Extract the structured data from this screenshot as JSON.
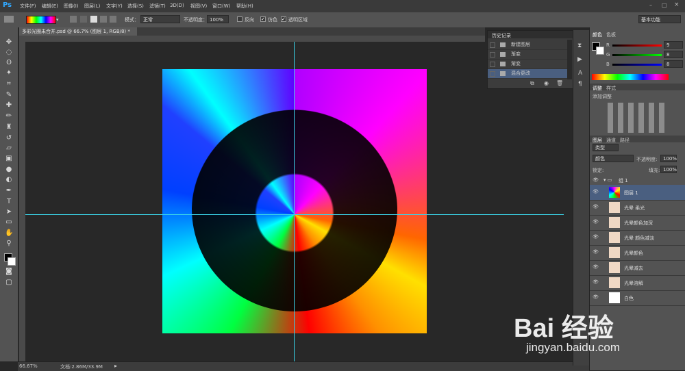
{
  "app": {
    "logo": "Ps"
  },
  "menu": [
    "文件(F)",
    "编辑(E)",
    "图像(I)",
    "图层(L)",
    "文字(Y)",
    "选择(S)",
    "滤镜(T)",
    "3D(D)",
    "视图(V)",
    "窗口(W)",
    "帮助(H)"
  ],
  "options": {
    "mode_label": "模式：",
    "mode_value": "正常",
    "opacity_label": "不透明度：",
    "opacity_value": "100%",
    "reverse_label": "反向",
    "dither_label": "仿色",
    "transparency_label": "透明区域",
    "workspace": "基本功能"
  },
  "document": {
    "tab_title": "多彩光圈未合并.psd @ 66.7% (图层 1, RGB/8) *",
    "zoom": "66.67%",
    "doc_info": "文档:2.86M/33.9M"
  },
  "history": {
    "title": "历史记录",
    "items": [
      "新建图层",
      "渐变",
      "渐变",
      "混合更改"
    ]
  },
  "color_panel": {
    "tab_color": "颜色",
    "tab_swatches": "色板",
    "r_label": "R",
    "g_label": "G",
    "b_label": "B",
    "r": "9",
    "g": "8",
    "b": "8"
  },
  "adjustments": {
    "tab_adjust": "调整",
    "tab_styles": "样式",
    "add_label": "添加调整"
  },
  "layers_panel": {
    "tab_layers": "图层",
    "tab_channels": "通道",
    "tab_paths": "路径",
    "filter_kind": "类型",
    "blend_mode": "颜色",
    "opacity_label": "不透明度:",
    "opacity_value": "100%",
    "lock_label": "锁定:",
    "fill_label": "填充:",
    "fill_value": "100%",
    "group_name": "组 1",
    "layers": [
      "图层 1",
      "光晕 柔光",
      "光晕颜色加深",
      "光晕 颜色减淡",
      "光晕颜色",
      "光晕减去",
      "光晕溶解",
      "白色"
    ]
  },
  "watermark": {
    "brand": "Bai 经验",
    "url": "jingyan.baidu.com"
  },
  "colors": {
    "guide": "#3ad3e8",
    "selected_layer": "#4a5f80",
    "ps_blue": "#31a8ff"
  }
}
